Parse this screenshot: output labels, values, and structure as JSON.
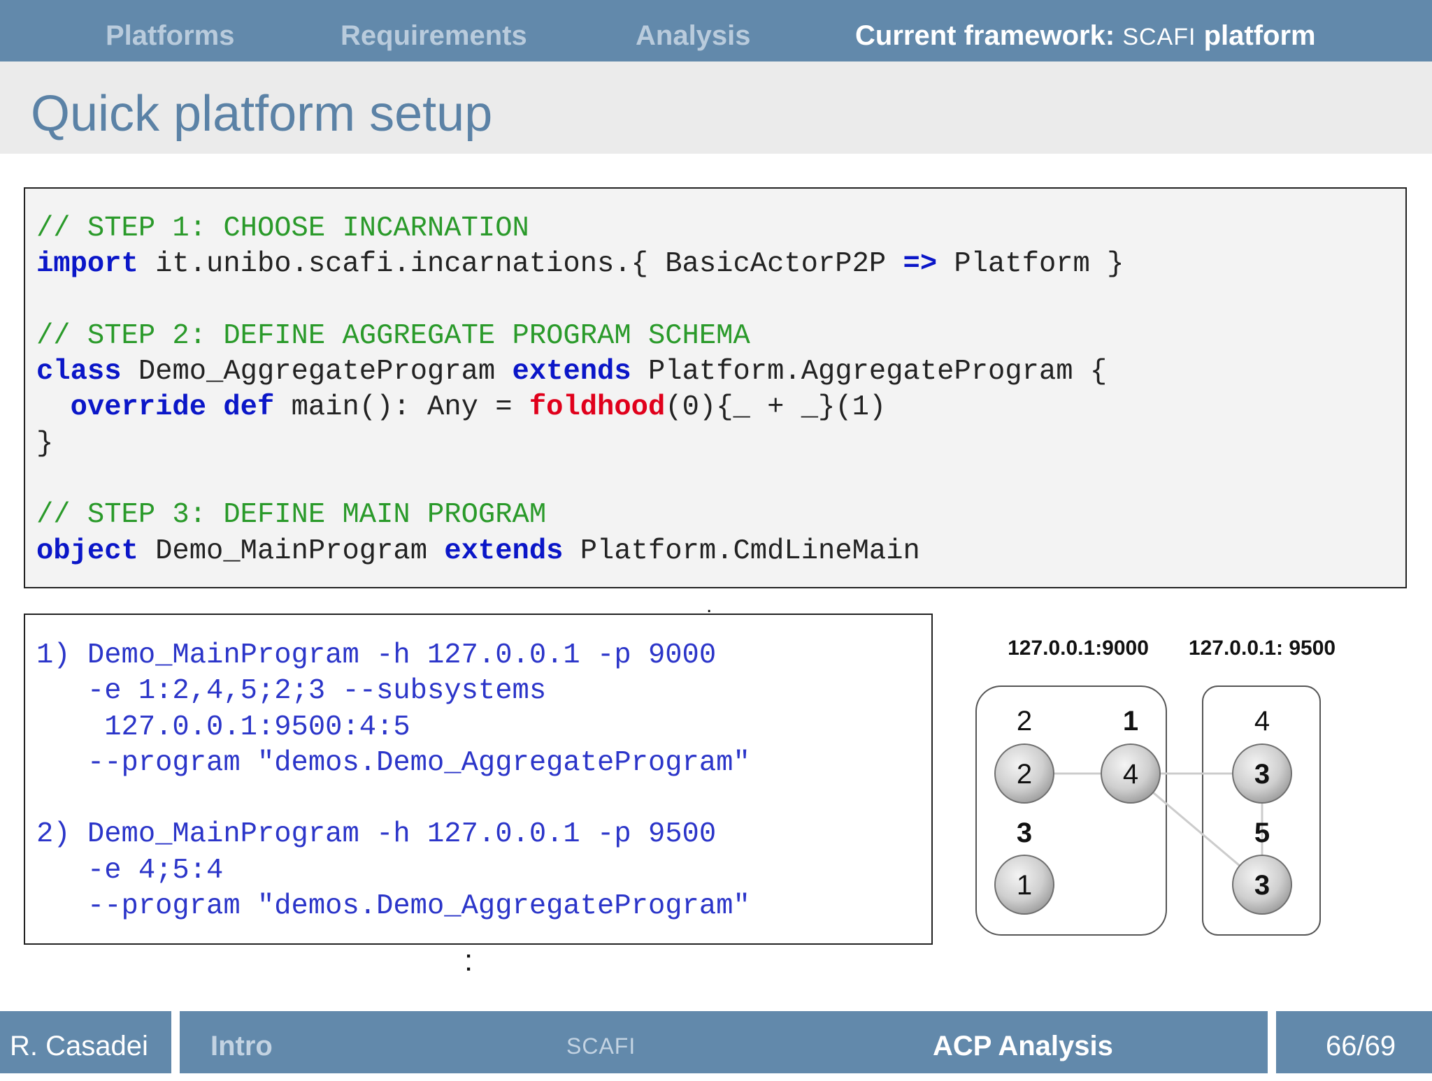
{
  "nav": {
    "items": [
      {
        "label": "Platforms"
      },
      {
        "label": "Requirements"
      },
      {
        "label": "Analysis"
      }
    ],
    "active": {
      "prefix": "Current framework:",
      "smallcaps": "SCAFI",
      "suffix": "platform"
    }
  },
  "page_title": "Quick platform setup",
  "code1": {
    "comment1": "// STEP 1: CHOOSE INCARNATION",
    "kw_import": "import",
    "import_path": " it.unibo.scafi.incarnations.{ BasicActorP2P ",
    "arrow": "=>",
    "import_tail": " Platform }",
    "comment2": "// STEP 2: DEFINE AGGREGATE PROGRAM SCHEMA",
    "kw_class": "class",
    "class_name": " Demo_AggregateProgram ",
    "kw_extends": "extends",
    "class_parent": " Platform.AggregateProgram {",
    "kw_override": "override",
    "kw_def": "def",
    "def_sig": " main(): Any = ",
    "fn_foldhood": "foldhood",
    "fold_args": "(0){_ + _}(1)",
    "close_brace": "}",
    "comment3": "// STEP 3: DEFINE MAIN PROGRAM",
    "kw_object": "object",
    "object_name": " Demo_MainProgram ",
    "kw_extends2": "extends",
    "object_parent": " Platform.CmdLineMain"
  },
  "code2": {
    "lines": [
      "1) Demo_MainProgram -h 127.0.0.1 -p 9000",
      "   -e 1:2,4,5;2;3 --subsystems",
      "    127.0.0.1:9500:4:5",
      "   --program \"demos.Demo_AggregateProgram\"",
      "",
      "2) Demo_MainProgram -h 127.0.0.1 -p 9500",
      "   -e 4;5:4",
      "   --program \"demos.Demo_AggregateProgram\""
    ]
  },
  "diagram": {
    "host1": "127.0.0.1:9000",
    "host2": "127.0.0.1: 9500",
    "nodes": [
      {
        "id": "2",
        "value": "2"
      },
      {
        "id": "1",
        "value": "4"
      },
      {
        "id": "3",
        "value": "1"
      },
      {
        "id": "4",
        "value": "3"
      },
      {
        "id": "5",
        "value": "3"
      }
    ]
  },
  "footer": {
    "author": "R. Casadei",
    "section": "Intro",
    "subsection": "SCAFI",
    "topic": "ACP Analysis",
    "page": "66/69"
  }
}
